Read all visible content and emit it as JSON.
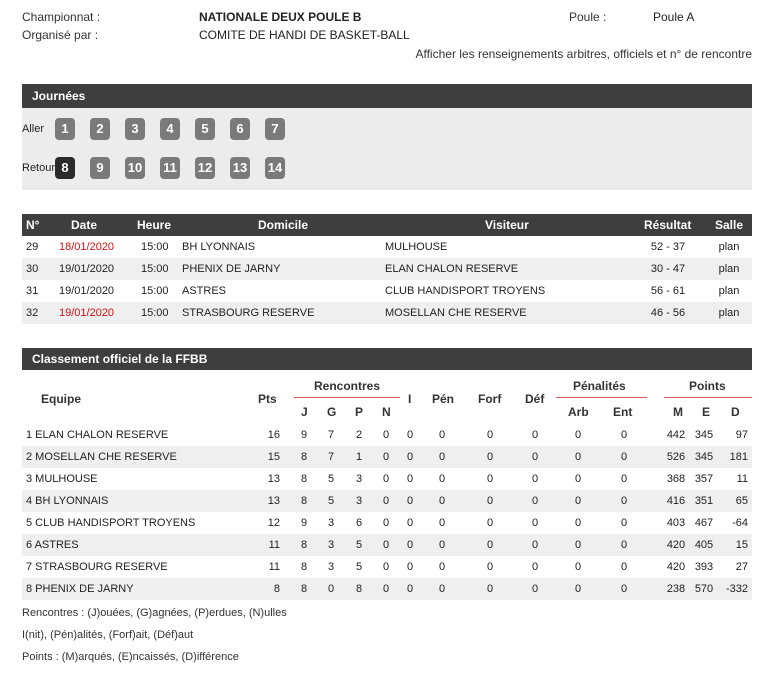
{
  "info": {
    "championnat_label": "Championnat :",
    "championnat_value": "NATIONALE DEUX POULE B",
    "poule_label": "Poule :",
    "poule_value": "Poule A",
    "organise_label": "Organisé par :",
    "organise_value": "COMITE DE HANDI DE BASKET-BALL",
    "arbitres_link": "Afficher les renseignements arbitres, officiels et n° de rencontre"
  },
  "journees": {
    "title": "Journées",
    "aller_label": "Aller",
    "retour_label": "Retour",
    "aller": [
      "1",
      "2",
      "3",
      "4",
      "5",
      "6",
      "7"
    ],
    "retour": [
      "8",
      "9",
      "10",
      "11",
      "12",
      "13",
      "14"
    ],
    "active": "8"
  },
  "matches": {
    "headers": {
      "num": "N°",
      "date": "Date",
      "heure": "Heure",
      "domicile": "Domicile",
      "visiteur": "Visiteur",
      "resultat": "Résultat",
      "salle": "Salle"
    },
    "rows": [
      {
        "num": "29",
        "date": "18/01/2020",
        "date_red": true,
        "heure": "15:00",
        "domicile": "BH LYONNAIS",
        "visiteur": "MULHOUSE",
        "resultat": "52 - 37",
        "salle": "plan"
      },
      {
        "num": "30",
        "date": "19/01/2020",
        "date_red": false,
        "heure": "15:00",
        "domicile": "PHENIX DE JARNY",
        "visiteur": "ELAN CHALON RESERVE",
        "resultat": "30 - 47",
        "salle": "plan"
      },
      {
        "num": "31",
        "date": "19/01/2020",
        "date_red": false,
        "heure": "15:00",
        "domicile": "ASTRES",
        "visiteur": "CLUB HANDISPORT TROYENS",
        "resultat": "56 - 61",
        "salle": "plan"
      },
      {
        "num": "32",
        "date": "19/01/2020",
        "date_red": true,
        "heure": "15:00",
        "domicile": "STRASBOURG RESERVE",
        "visiteur": "MOSELLAN CHE RESERVE",
        "resultat": "46 - 56",
        "salle": "plan"
      }
    ]
  },
  "classement": {
    "title": "Classement officiel de la FFBB",
    "headers": {
      "equipe": "Equipe",
      "pts": "Pts",
      "rencontres": "Rencontres",
      "j": "J",
      "g": "G",
      "p": "P",
      "n": "N",
      "i": "I",
      "pen": "Pén",
      "forf": "Forf",
      "def": "Déf",
      "penalites": "Pénalités",
      "arb": "Arb",
      "ent": "Ent",
      "points": "Points",
      "m": "M",
      "e": "E",
      "d": "D"
    },
    "rows": [
      {
        "equipe": "1 ELAN CHALON RESERVE",
        "pts": "16",
        "j": "9",
        "g": "7",
        "p": "2",
        "n": "0",
        "i": "0",
        "pen": "0",
        "forf": "0",
        "def": "0",
        "arb": "0",
        "ent": "0",
        "m": "442",
        "e": "345",
        "d": "97"
      },
      {
        "equipe": "2 MOSELLAN CHE RESERVE",
        "pts": "15",
        "j": "8",
        "g": "7",
        "p": "1",
        "n": "0",
        "i": "0",
        "pen": "0",
        "forf": "0",
        "def": "0",
        "arb": "0",
        "ent": "0",
        "m": "526",
        "e": "345",
        "d": "181"
      },
      {
        "equipe": "3 MULHOUSE",
        "pts": "13",
        "j": "8",
        "g": "5",
        "p": "3",
        "n": "0",
        "i": "0",
        "pen": "0",
        "forf": "0",
        "def": "0",
        "arb": "0",
        "ent": "0",
        "m": "368",
        "e": "357",
        "d": "11"
      },
      {
        "equipe": "4 BH LYONNAIS",
        "pts": "13",
        "j": "8",
        "g": "5",
        "p": "3",
        "n": "0",
        "i": "0",
        "pen": "0",
        "forf": "0",
        "def": "0",
        "arb": "0",
        "ent": "0",
        "m": "416",
        "e": "351",
        "d": "65"
      },
      {
        "equipe": "5 CLUB HANDISPORT TROYENS",
        "pts": "12",
        "j": "9",
        "g": "3",
        "p": "6",
        "n": "0",
        "i": "0",
        "pen": "0",
        "forf": "0",
        "def": "0",
        "arb": "0",
        "ent": "0",
        "m": "403",
        "e": "467",
        "d": "-64"
      },
      {
        "equipe": "6 ASTRES",
        "pts": "11",
        "j": "8",
        "g": "3",
        "p": "5",
        "n": "0",
        "i": "0",
        "pen": "0",
        "forf": "0",
        "def": "0",
        "arb": "0",
        "ent": "0",
        "m": "420",
        "e": "405",
        "d": "15"
      },
      {
        "equipe": "7 STRASBOURG RESERVE",
        "pts": "11",
        "j": "8",
        "g": "3",
        "p": "5",
        "n": "0",
        "i": "0",
        "pen": "0",
        "forf": "0",
        "def": "0",
        "arb": "0",
        "ent": "0",
        "m": "420",
        "e": "393",
        "d": "27"
      },
      {
        "equipe": "8 PHENIX DE JARNY",
        "pts": "8",
        "j": "8",
        "g": "0",
        "p": "8",
        "n": "0",
        "i": "0",
        "pen": "0",
        "forf": "0",
        "def": "0",
        "arb": "0",
        "ent": "0",
        "m": "238",
        "e": "570",
        "d": "-332"
      }
    ]
  },
  "legend": {
    "line1": "Rencontres : (J)ouées, (G)agnées, (P)erdues, (N)ulles",
    "line2": "I(nit), (Pén)alités, (Forf)ait, (Déf)aut",
    "line3": "Points : (M)arqués, (E)ncaissés, (D)ifférence"
  }
}
